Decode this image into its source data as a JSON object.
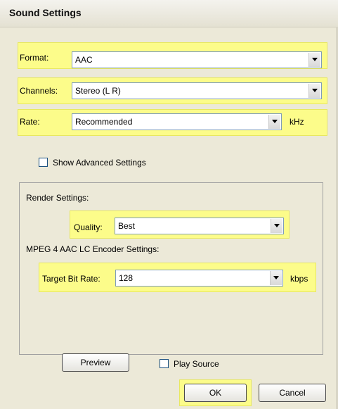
{
  "window": {
    "title": "Sound Settings"
  },
  "format": {
    "label": "Format:",
    "value": "AAC"
  },
  "channels": {
    "label": "Channels:",
    "value": "Stereo (L R)"
  },
  "rate": {
    "label": "Rate:",
    "value": "Recommended",
    "unit": "kHz"
  },
  "advanced": {
    "label": "Show Advanced Settings",
    "checked": false
  },
  "render": {
    "section_label": "Render Settings:",
    "quality": {
      "label": "Quality:",
      "value": "Best"
    }
  },
  "encoder": {
    "section_label": "MPEG 4 AAC LC Encoder Settings:",
    "bitrate": {
      "label": "Target Bit Rate:",
      "value": "128",
      "unit": "kbps"
    }
  },
  "buttons": {
    "preview": "Preview",
    "ok": "OK",
    "cancel": "Cancel"
  },
  "play_source": {
    "label": "Play Source",
    "checked": false
  },
  "colors": {
    "highlight": "#fcfc8a",
    "face": "#ece9d8",
    "combo_border": "#7f9db9"
  }
}
